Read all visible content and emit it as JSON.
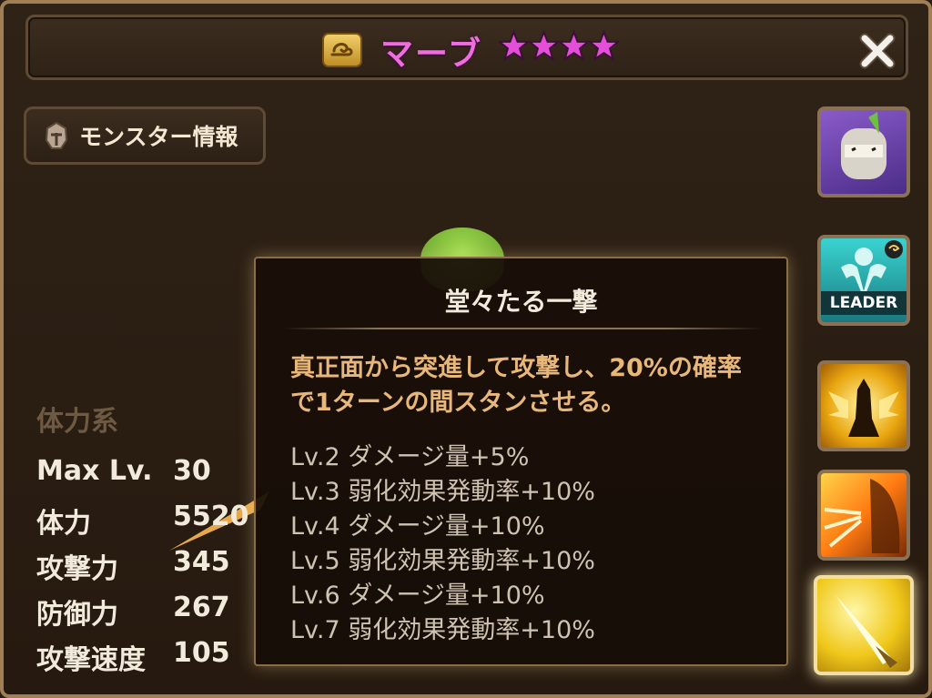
{
  "header": {
    "title": "マーブ",
    "star_count": 4,
    "element_icon": "wind-element-icon",
    "close_icon": "close-icon"
  },
  "info_tab": {
    "label": "モンスター情報",
    "icon": "helmet-icon"
  },
  "stats": {
    "heading": "体力系",
    "rows": [
      {
        "label": "Max Lv.",
        "value": "30"
      },
      {
        "label": "体力",
        "value": "5520"
      },
      {
        "label": "攻撃力",
        "value": "345"
      },
      {
        "label": "防御力",
        "value": "267"
      },
      {
        "label": "攻撃速度",
        "value": "105"
      }
    ]
  },
  "tooltip": {
    "title": "堂々たる一撃",
    "description": "真正面から突進して攻撃し、20%の確率で1ターンの間スタンさせる。",
    "levels": [
      "Lv.2 ダメージ量+5%",
      "Lv.3 弱化効果発動率+10%",
      "Lv.4 ダメージ量+10%",
      "Lv.5 弱化効果発動率+10%",
      "Lv.6 ダメージ量+10%",
      "Lv.7 弱化効果発動率+10%"
    ]
  },
  "sidebar": {
    "leader_label": "LEADER",
    "buttons": [
      "monster-portrait",
      "leader-skill",
      "skill-1",
      "skill-2",
      "skill-3"
    ],
    "active": "skill-3"
  },
  "colors": {
    "title": "#f06de0",
    "star": "#e54ed8",
    "description": "#e8b77a",
    "stat_heading": "#6e5a43",
    "frame_border": "#a07f55"
  }
}
